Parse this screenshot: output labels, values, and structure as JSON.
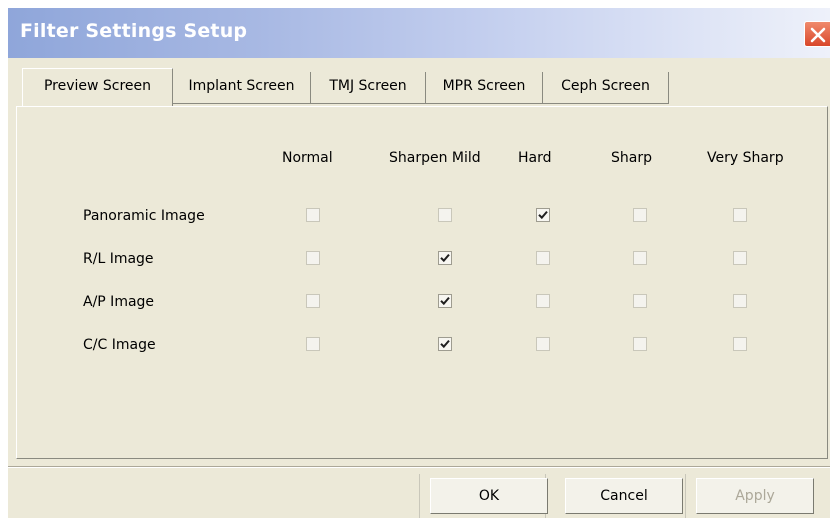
{
  "window": {
    "title": "Filter Settings Setup"
  },
  "tabs": [
    {
      "label": "Preview Screen",
      "active": true
    },
    {
      "label": "Implant Screen",
      "active": false
    },
    {
      "label": "TMJ Screen",
      "active": false
    },
    {
      "label": "MPR Screen",
      "active": false
    },
    {
      "label": "Ceph Screen",
      "active": false
    }
  ],
  "columns": [
    "Normal",
    "Sharpen Mild",
    "Hard",
    "Sharp",
    "Very Sharp"
  ],
  "rows": [
    {
      "label": "Panoramic Image",
      "checked": [
        false,
        false,
        true,
        false,
        false
      ]
    },
    {
      "label": "R/L Image",
      "checked": [
        false,
        true,
        false,
        false,
        false
      ]
    },
    {
      "label": "A/P Image",
      "checked": [
        false,
        true,
        false,
        false,
        false
      ]
    },
    {
      "label": "C/C Image",
      "checked": [
        false,
        true,
        false,
        false,
        false
      ]
    }
  ],
  "buttons": {
    "ok": "OK",
    "cancel": "Cancel",
    "apply": "Apply"
  },
  "colors": {
    "dialog_bg": "#ece9d8",
    "title_text": "#ffffff",
    "close_red": "#d9472a"
  }
}
